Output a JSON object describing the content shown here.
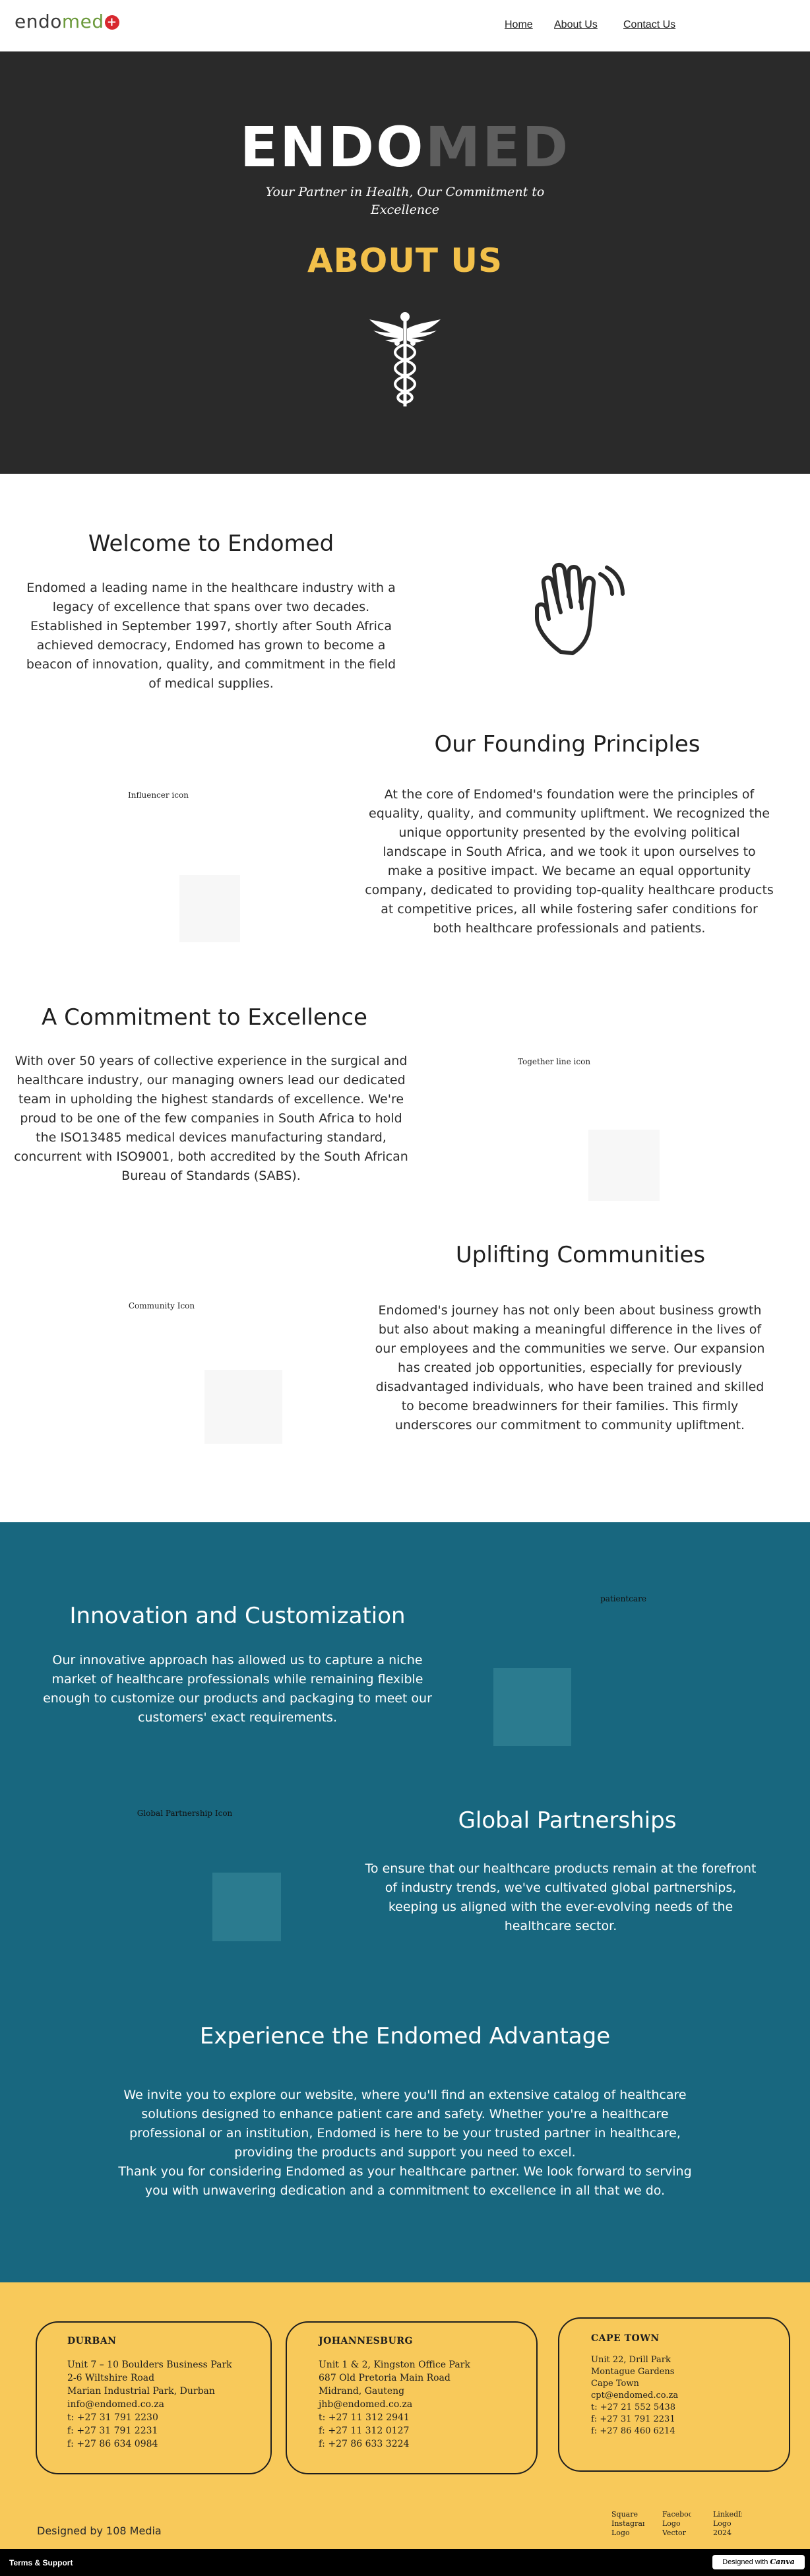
{
  "header": {
    "logo": {
      "part1": "endo",
      "part2": "med",
      "cross": "+"
    },
    "nav": [
      {
        "label": "Home"
      },
      {
        "label": "About Us"
      },
      {
        "label": "Contact Us"
      }
    ]
  },
  "hero": {
    "title_part1": "ENDO",
    "title_part2": "MED",
    "tagline": "Your Partner in Health, Our Commitment to Excellence",
    "heading": "ABOUT US",
    "icon": "caduceus-icon",
    "colors": {
      "background": "#2a2a2a",
      "accent": "#f2c04a"
    }
  },
  "welcome": {
    "heading": "Welcome to Endomed",
    "text": "Endomed a leading name in the healthcare industry with a legacy of excellence that spans over two decades. Established in September 1997, shortly after South Africa achieved democracy, Endomed has grown to become a beacon of innovation, quality, and commitment in the field of medical supplies.",
    "icon": "waving-hand-icon"
  },
  "founding": {
    "heading": "Our Founding Principles",
    "image_label": "Influencer icon",
    "text": "At the core of Endomed's foundation were the principles of equality, quality, and community upliftment. We recognized the unique opportunity presented by the evolving political landscape in South Africa, and we took it upon ourselves to make a positive impact. We became an equal opportunity company, dedicated to providing top-quality healthcare products at competitive prices, all while fostering safer conditions for both healthcare professionals and patients."
  },
  "commitment": {
    "heading": "A Commitment to Excellence",
    "image_label": "Together line icon",
    "text": "With over 50 years of collective experience in the surgical and healthcare industry, our managing owners lead our dedicated team in upholding the highest standards of excellence. We're proud to be one of the few companies in South Africa to hold the ISO13485 medical devices manufacturing standard, concurrent with ISO9001, both accredited by the South African Bureau of Standards (SABS)."
  },
  "uplifting": {
    "heading": "Uplifting Communities",
    "image_label": "Community Icon",
    "text": "Endomed's journey has not only been about business growth but also about making a meaningful difference in the lives of our employees and the communities we serve. Our expansion has created job opportunities, especially for previously disadvantaged individuals, who have been trained and skilled to become breadwinners for their families. This firmly underscores our commitment to community upliftment."
  },
  "innovation": {
    "heading": "Innovation and Customization",
    "image_label": "patientcare",
    "text": "Our innovative approach has allowed us to capture a niche market of healthcare professionals while remaining flexible enough to customize our products and packaging to meet our customers' exact requirements.",
    "colors": {
      "background": "#18677f"
    }
  },
  "partnerships": {
    "heading": "Global Partnerships",
    "image_label": "Global Partnership Icon",
    "text": "To ensure that our healthcare products remain at the forefront of industry trends, we've cultivated global partnerships, keeping us aligned with the ever-evolving needs of the healthcare sector."
  },
  "advantage": {
    "heading": "Experience the Endomed Advantage",
    "text": "We invite you to explore our website, where you'll find an extensive catalog of healthcare solutions designed to enhance patient care and safety. Whether you're a healthcare professional or an institution, Endomed is here to be your trusted partner in healthcare, providing the products and support you need to excel.",
    "text2": "Thank you for considering Endomed as your healthcare partner. We look forward to serving you with unwavering dedication and a commitment to excellence in all that we do."
  },
  "footer": {
    "colors": {
      "background": "#f8c95a"
    },
    "offices": [
      {
        "title": "DURBAN",
        "lines": [
          "Unit 7 – 10 Boulders Business Park",
          "2-6 Wiltshire Road",
          "Marian Industrial Park, Durban",
          "info@endomed.co.za",
          "t: +27 31 791 2230",
          "f: +27 31 791 2231",
          "f: +27 86 634 0984"
        ]
      },
      {
        "title": "JOHANNESBURG",
        "lines": [
          "Unit 1 & 2, Kingston Office Park",
          "687 Old Pretoria Main Road",
          "Midrand, Gauteng",
          "jhb@endomed.co.za",
          "t: +27 11 312 2941",
          "f: +27 11 312 0127",
          "f: +27 86 633 3224"
        ]
      },
      {
        "title": "CAPE TOWN",
        "lines": [
          "Unit 22, Drill Park",
          "Montague Gardens",
          "Cape Town",
          "cpt@endomed.co.za",
          "t: +27 21 552 5438",
          "f: +27 31 791 2231",
          "f: +27 86 460 6214"
        ]
      }
    ],
    "designed_by": "Designed by 108 Media",
    "social": [
      {
        "label": "Square Instagram Logo"
      },
      {
        "label": "Facebook Logo Vector"
      },
      {
        "label": "LinkedIn Logo 2024"
      }
    ]
  },
  "bottom_bar": {
    "terms": "Terms & Support",
    "canva_prefix": "Designed with",
    "canva_brand": "Canva"
  }
}
